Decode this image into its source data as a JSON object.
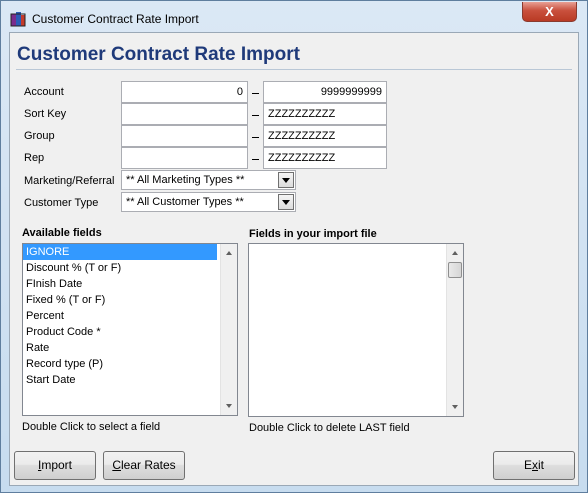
{
  "window": {
    "title": "Customer Contract Rate Import",
    "close_label": "X"
  },
  "heading": "Customer Contract Rate Import",
  "filters": {
    "account": {
      "label": "Account",
      "from": "0",
      "to": "9999999999"
    },
    "sort_key": {
      "label": "Sort Key",
      "from": "",
      "to": "ZZZZZZZZZZ"
    },
    "group": {
      "label": "Group",
      "from": "",
      "to": "ZZZZZZZZZZ"
    },
    "rep": {
      "label": "Rep",
      "from": "",
      "to": "ZZZZZZZZZZ"
    },
    "marketing": {
      "label": "Marketing/Referral",
      "value": "** All Marketing Types **"
    },
    "customer_type": {
      "label": "Customer Type",
      "value": "** All Customer Types **"
    }
  },
  "available": {
    "title": "Available fields",
    "items": [
      "IGNORE",
      "Discount % (T or F)",
      "FInish Date",
      "Fixed % (T or F)",
      "Percent",
      "Product Code *",
      "Rate",
      "Record type (P)",
      "Start Date"
    ],
    "selected_index": 0,
    "hint": "Double Click to select a field"
  },
  "import_file": {
    "title": "Fields in your import file",
    "items": [],
    "hint": "Double Click to delete LAST field"
  },
  "buttons": {
    "import": {
      "mnemonic": "I",
      "rest": "mport"
    },
    "clear_rates": {
      "mnemonic": "C",
      "rest": "lear Rates"
    },
    "exit": {
      "pre": "E",
      "mnemonic": "x",
      "rest": "it"
    }
  },
  "colors": {
    "heading": "#1f3a7a",
    "selection": "#3399ff",
    "close": "#c9503d"
  }
}
